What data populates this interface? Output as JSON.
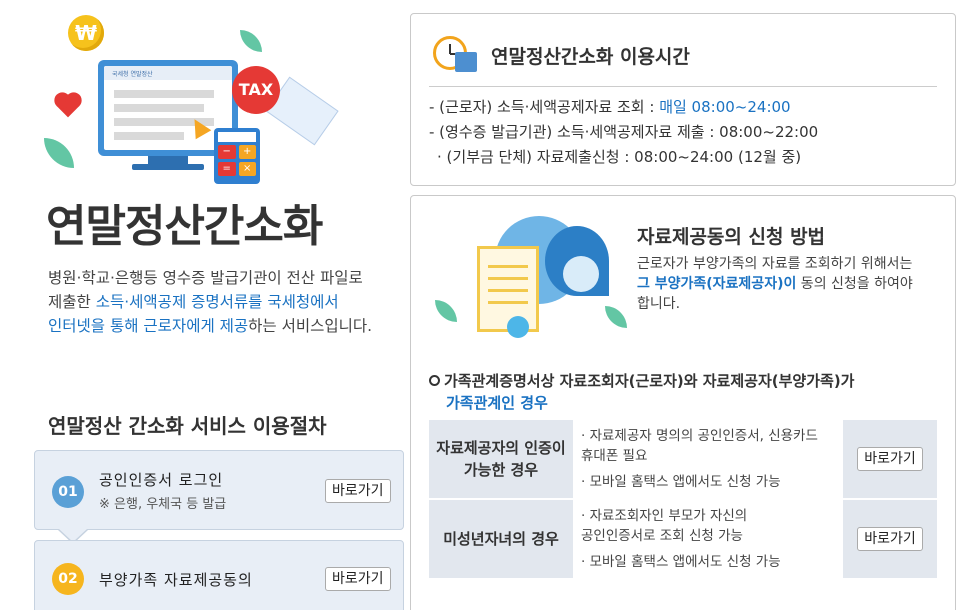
{
  "hero": {
    "coin_symbol": "₩",
    "tax_label": "TAX",
    "screen_logo": "국세청 연말정산"
  },
  "left": {
    "title": "연말정산간소화",
    "desc": {
      "line1": "병원·학교·은행등 영수증 발급기관이 전산 파일로",
      "line2_a": "제출한 ",
      "line2_b": "소득·세액공제 증명서류를 국세청에서",
      "line3_a": "인터넷을 통해 근로자에게 제공",
      "line3_b": "하는 서비스입니다."
    },
    "procedure_title": "연말정산 간소화 서비스 이용절차",
    "steps": [
      {
        "num": "01",
        "label": "공인인증서 로그인",
        "sub": "※ 은행, 우체국 등 발급",
        "button": "바로가기"
      },
      {
        "num": "02",
        "label": "부양가족 자료제공동의",
        "button": "바로가기"
      }
    ]
  },
  "usage_time": {
    "title": "연말정산간소화 이용시간",
    "lines": [
      {
        "label": "- (근로자) 소득·세액공제자료 조회 : ",
        "value": "매일 08:00~24:00"
      },
      {
        "label": "- (영수증 발급기관) 소득·세액공제자료 제출 : ",
        "value": "08:00~22:00"
      },
      {
        "label": "  · (기부금 단체) 자료제출신청 : ",
        "value": "08:00~24:00 (12월 중)"
      }
    ]
  },
  "apply": {
    "title": "자료제공동의 신청 방법",
    "desc_a": "근로자가 부양가족의 자료를 조회하기 위해서는",
    "desc_b": "그 부양가족(자료제공자)이",
    "desc_c": " 동의 신청을 하여야",
    "desc_d": "합니다.",
    "condition_a": "가족관계증명서상 자료조회자(근로자)와 자료제공자(부양가족)가",
    "condition_b": "가족관계인 경우",
    "rows": [
      {
        "head": "자료제공자의 인증이 가능한 경우",
        "items": [
          "· 자료제공자 명의의 공인인증서, 신용카드",
          "  휴대폰 필요",
          "· 모바일 홈택스 앱에서도 신청 가능"
        ],
        "button": "바로가기"
      },
      {
        "head": "미성년자녀의 경우",
        "items": [
          "· 자료조회자인 부모가 자신의",
          "  공인인증서로 조회 신청 가능",
          "· 모바일 홈택스 앱에서도 신청 가능"
        ],
        "button": "바로가기"
      }
    ]
  },
  "colors": {
    "accent_blue": "#1a72c2",
    "step_blue": "#5aa0d6",
    "step_yellow": "#f6b51e",
    "tax_red": "#e53935"
  }
}
